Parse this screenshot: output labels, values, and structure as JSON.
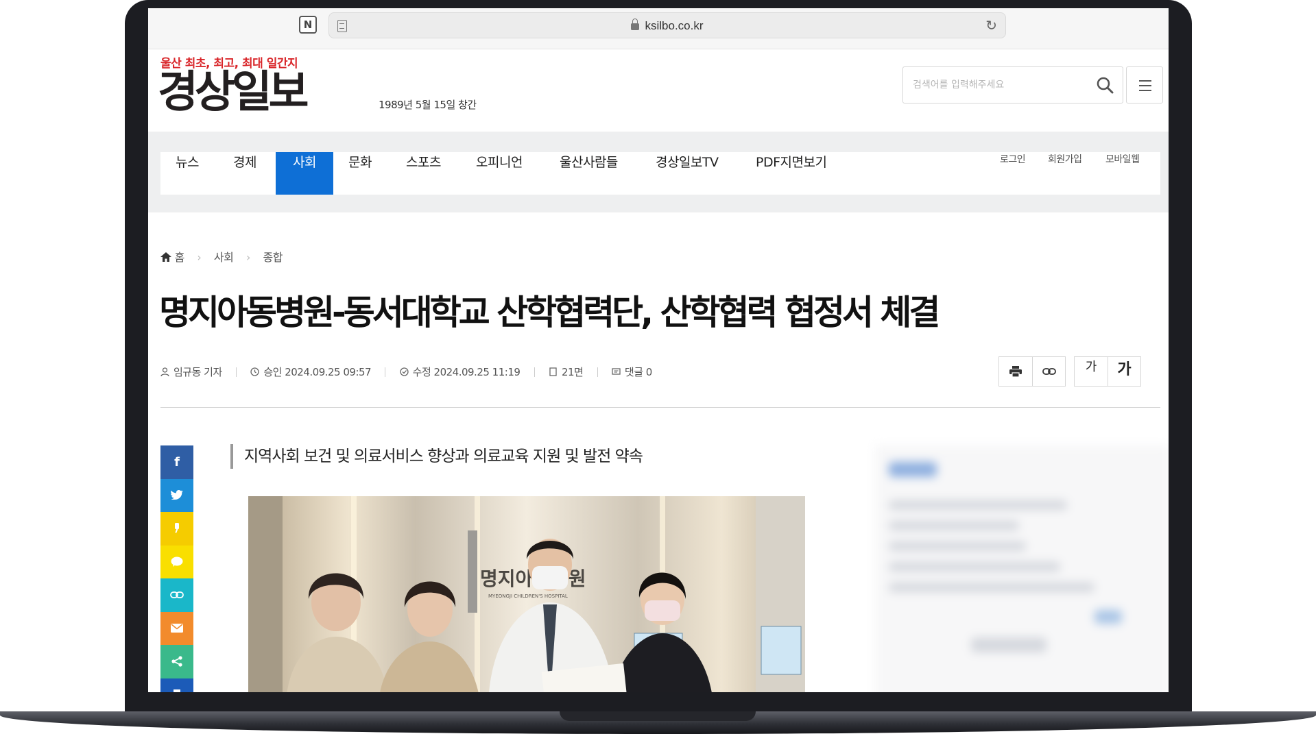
{
  "browser": {
    "url": "ksilbo.co.kr"
  },
  "site": {
    "tagline": "울산 최초, 최고, 최대 일간지",
    "logo_text": "경상일보",
    "founded": "1989년 5월 15일 창간",
    "search_placeholder": "검색어를 입력해주세요",
    "brand_red": "#d9262a",
    "accent_blue": "#0e6fd6"
  },
  "nav": {
    "items": [
      {
        "label": "뉴스",
        "active": false
      },
      {
        "label": "경제",
        "active": false
      },
      {
        "label": "사회",
        "active": true
      },
      {
        "label": "문화",
        "active": false
      },
      {
        "label": "스포츠",
        "active": false
      },
      {
        "label": "오피니언",
        "active": false
      },
      {
        "label": "울산사람들",
        "active": false
      },
      {
        "label": "경상일보TV",
        "active": false
      },
      {
        "label": "PDF지면보기",
        "active": false
      }
    ],
    "util": [
      "로그인",
      "회원가입",
      "모바일웹"
    ]
  },
  "breadcrumb": [
    "홈",
    "사회",
    "종합"
  ],
  "article": {
    "headline": "명지아동병원-동서대학교 산학협력단, 산학협력 협정서 체결",
    "author": "임규동 기자",
    "approved": "승인 2024.09.25 09:57",
    "modified": "수정 2024.09.25 11:19",
    "page": "21면",
    "comments": "댓글 0",
    "subtitle": "지역사회 보건 및 의료서비스 향상과 의료교육 지원 및 발전 약속",
    "photo_sign_text": "명지아동병원",
    "photo_sign_sub": "MYEONGJI CHILDREN'S HOSPITAL"
  },
  "tools": {
    "font_small": "가",
    "font_large": "가",
    "icons": [
      "print-icon",
      "link-icon"
    ]
  },
  "share": {
    "buttons": [
      {
        "name": "facebook",
        "glyph": "f",
        "color": "#2f5ea5"
      },
      {
        "name": "twitter",
        "glyph": "",
        "color": "#1d8ed8"
      },
      {
        "name": "kakaostory",
        "glyph": "",
        "color": "#f5cc00"
      },
      {
        "name": "kakaotalk",
        "glyph": "",
        "color": "#f9df00"
      },
      {
        "name": "link",
        "glyph": "",
        "color": "#1ab7c9"
      },
      {
        "name": "email",
        "glyph": "",
        "color": "#f28b2c"
      },
      {
        "name": "share",
        "glyph": "",
        "color": "#3ab98b"
      },
      {
        "name": "bookmark",
        "glyph": "",
        "color": "#1c5bb8"
      }
    ]
  }
}
